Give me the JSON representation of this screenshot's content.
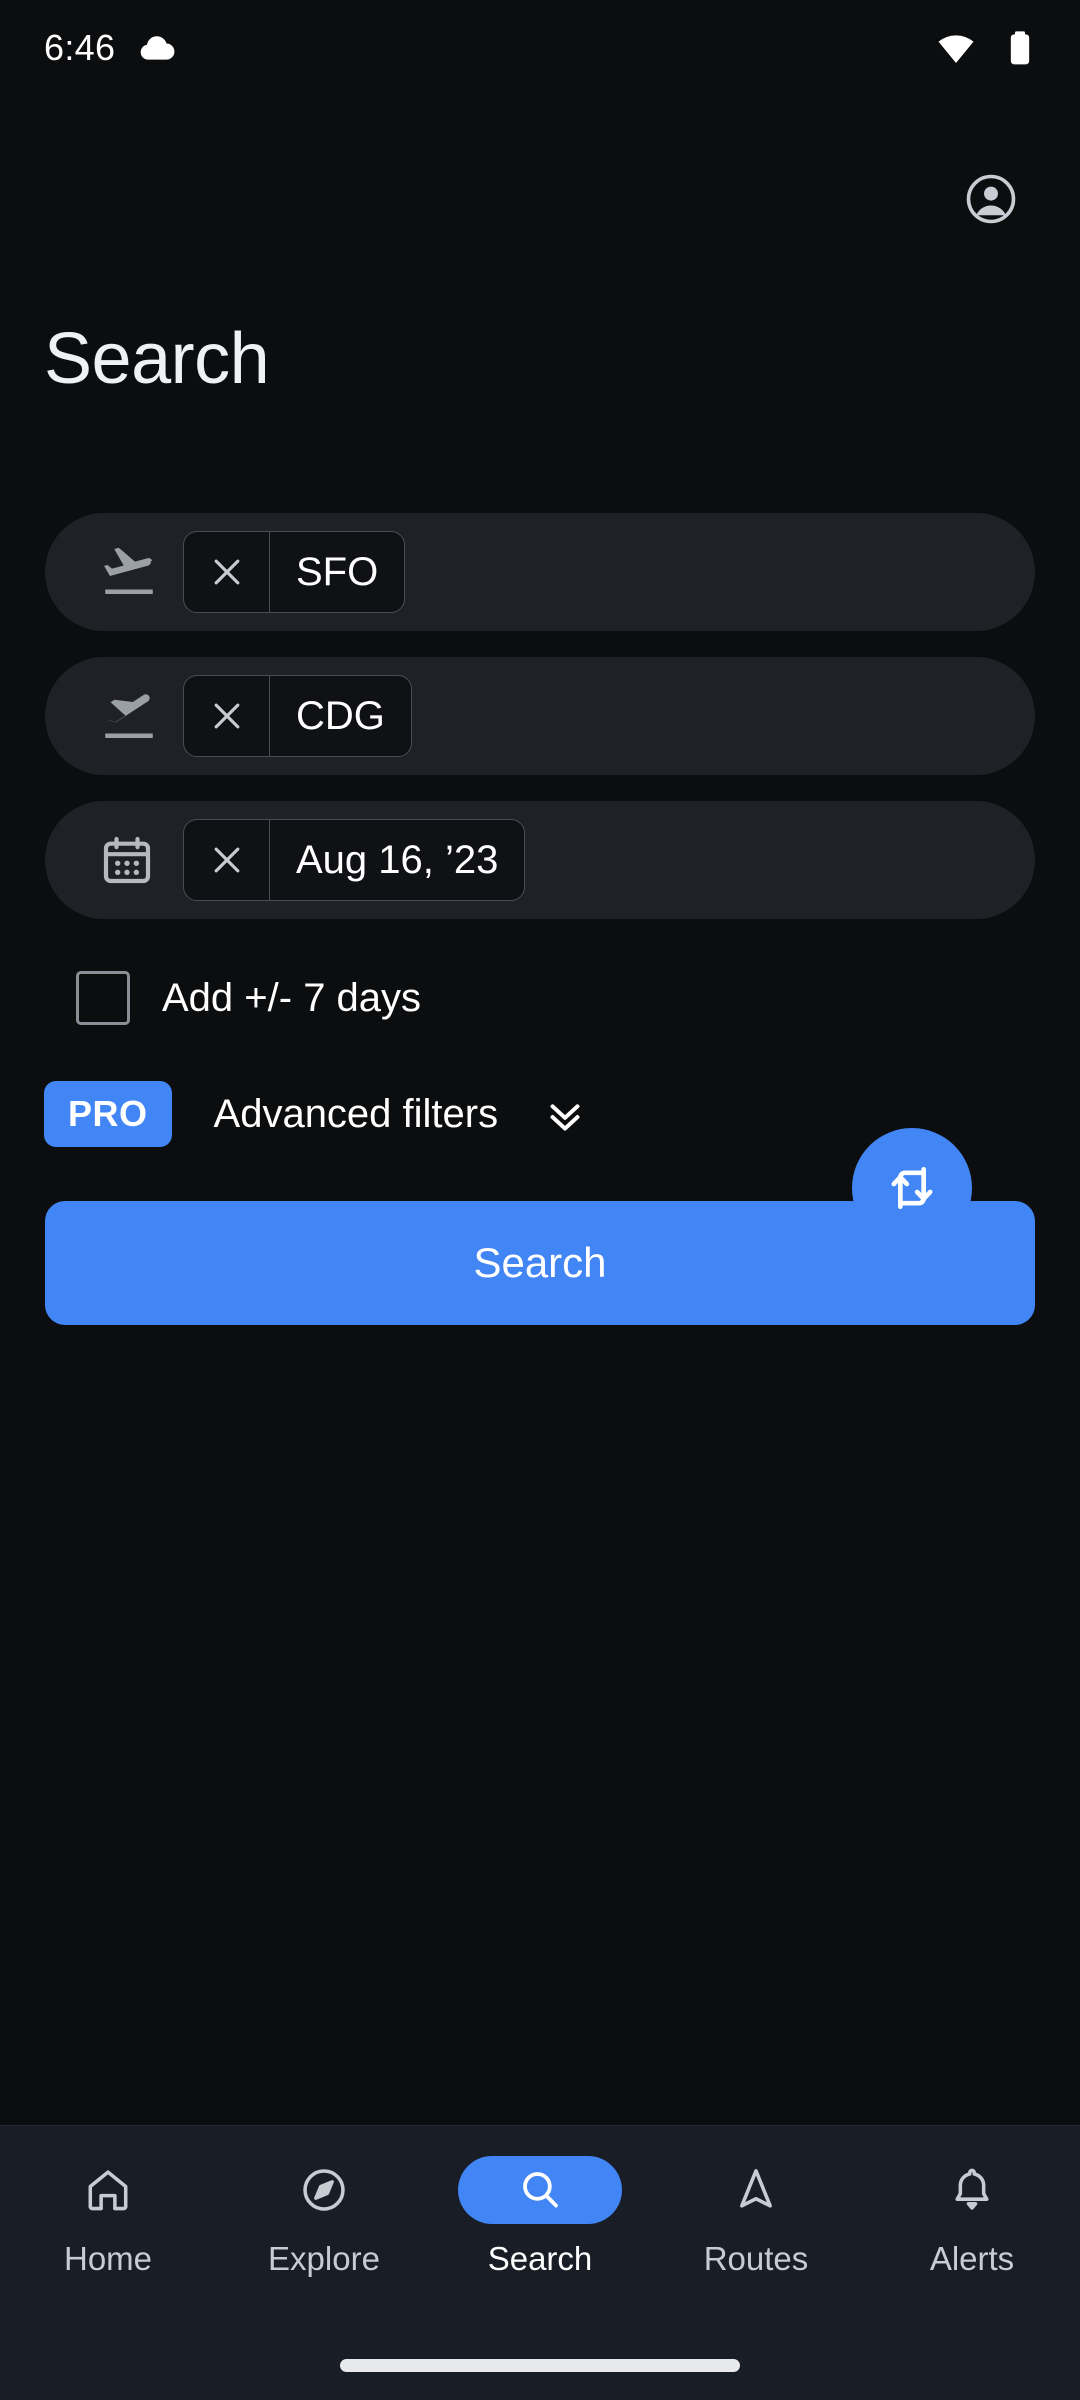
{
  "status_bar": {
    "time": "6:46",
    "weather_icon": "cloud-icon",
    "wifi_icon": "wifi-icon",
    "battery_icon": "battery-icon"
  },
  "header": {
    "account_icon": "account-circle-icon",
    "title": "Search"
  },
  "colors": {
    "accent": "#4285f4",
    "page_background": "#0c0d0f",
    "field_background": "#1f2126",
    "nav_background": "#191d25"
  },
  "form": {
    "fields": [
      {
        "name": "origin",
        "icon": "flight-takeoff-icon",
        "clear_label": "×",
        "value": "SFO"
      },
      {
        "name": "destination",
        "icon": "flight-land-icon",
        "clear_label": "×",
        "value": "CDG"
      },
      {
        "name": "date",
        "icon": "calendar-icon",
        "clear_label": "×",
        "value": "Aug 16, ’23"
      }
    ],
    "swap_icon": "swap-vertical-icon",
    "flex_dates": {
      "checked": false,
      "label": "Add +/- 7 days"
    },
    "advanced_filters": {
      "badge": "PRO",
      "label": "Advanced filters",
      "chevron_icon": "double-chevron-down-icon"
    },
    "submit_label": "Search"
  },
  "bottom_nav": {
    "items": [
      {
        "label": "Home",
        "icon": "home-icon",
        "active": false
      },
      {
        "label": "Explore",
        "icon": "compass-icon",
        "active": false
      },
      {
        "label": "Search",
        "icon": "search-icon",
        "active": true
      },
      {
        "label": "Routes",
        "icon": "navigation-icon",
        "active": false
      },
      {
        "label": "Alerts",
        "icon": "bell-icon",
        "active": false
      }
    ]
  }
}
